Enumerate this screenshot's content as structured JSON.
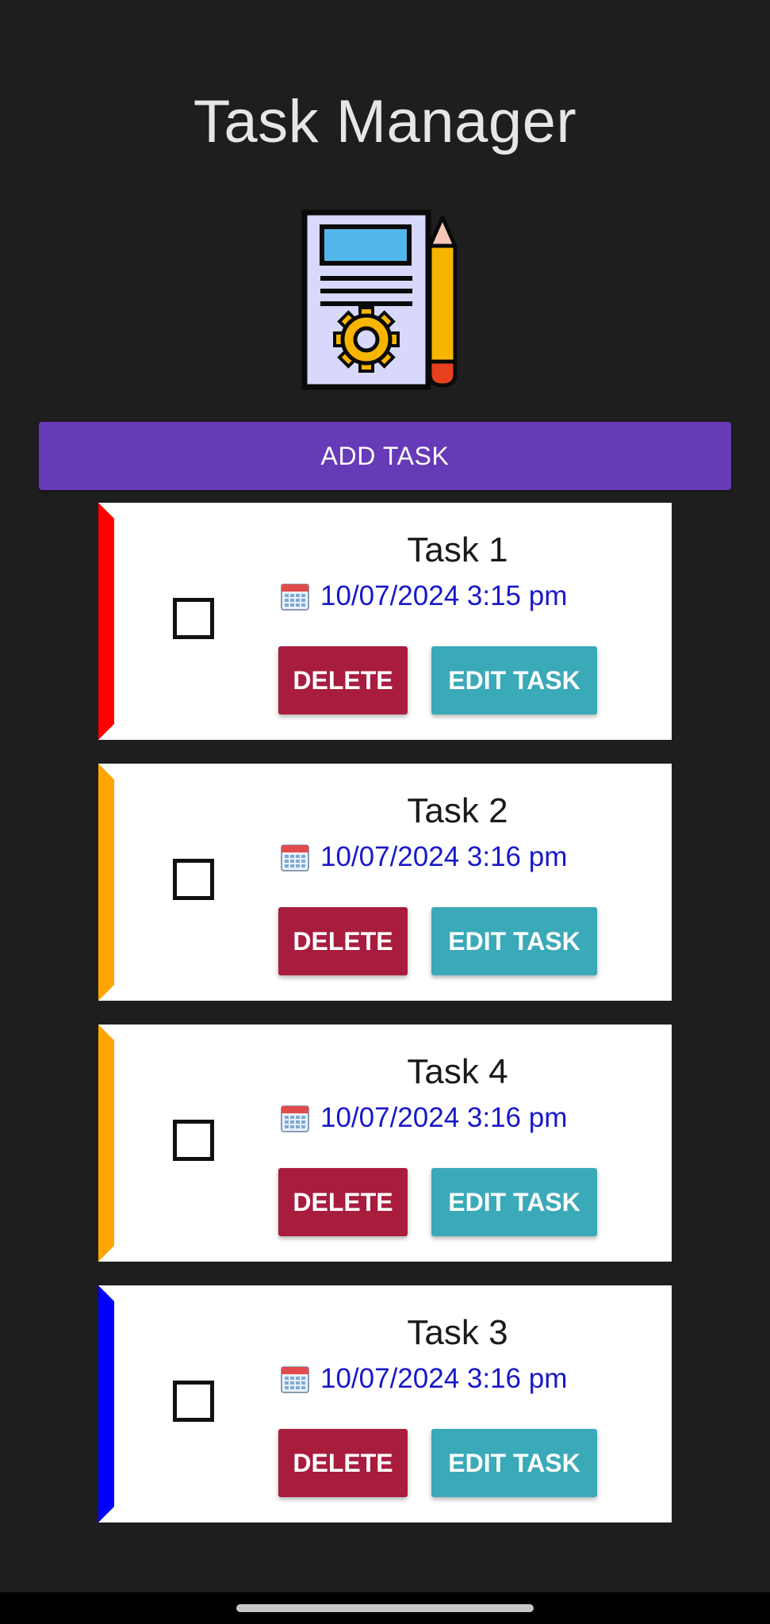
{
  "app": {
    "title": "Task Manager"
  },
  "actions": {
    "add_task_label": "ADD TASK"
  },
  "tasks": [
    {
      "name": "Task 1",
      "date": "10/07/2024 3:15 pm",
      "priority_color": "#ff0000",
      "checked": false,
      "delete_label": "DELETE",
      "edit_label": "EDIT TASK"
    },
    {
      "name": "Task 2",
      "date": "10/07/2024 3:16 pm",
      "priority_color": "#ffa500",
      "checked": false,
      "delete_label": "DELETE",
      "edit_label": "EDIT TASK"
    },
    {
      "name": "Task 4",
      "date": "10/07/2024 3:16 pm",
      "priority_color": "#ffa500",
      "checked": false,
      "delete_label": "DELETE",
      "edit_label": "EDIT TASK"
    },
    {
      "name": "Task 3",
      "date": "10/07/2024 3:16 pm",
      "priority_color": "#0000ff",
      "checked": false,
      "delete_label": "DELETE",
      "edit_label": "EDIT TASK"
    }
  ],
  "icons": {
    "logo": "task-document-gear-pencil-icon",
    "date": "calendar-icon"
  },
  "colors": {
    "background": "#1e1e1e",
    "add_button": "#673ab7",
    "delete_button": "#a81d3e",
    "edit_button": "#3aa9b8",
    "date_text": "#1818c8"
  }
}
